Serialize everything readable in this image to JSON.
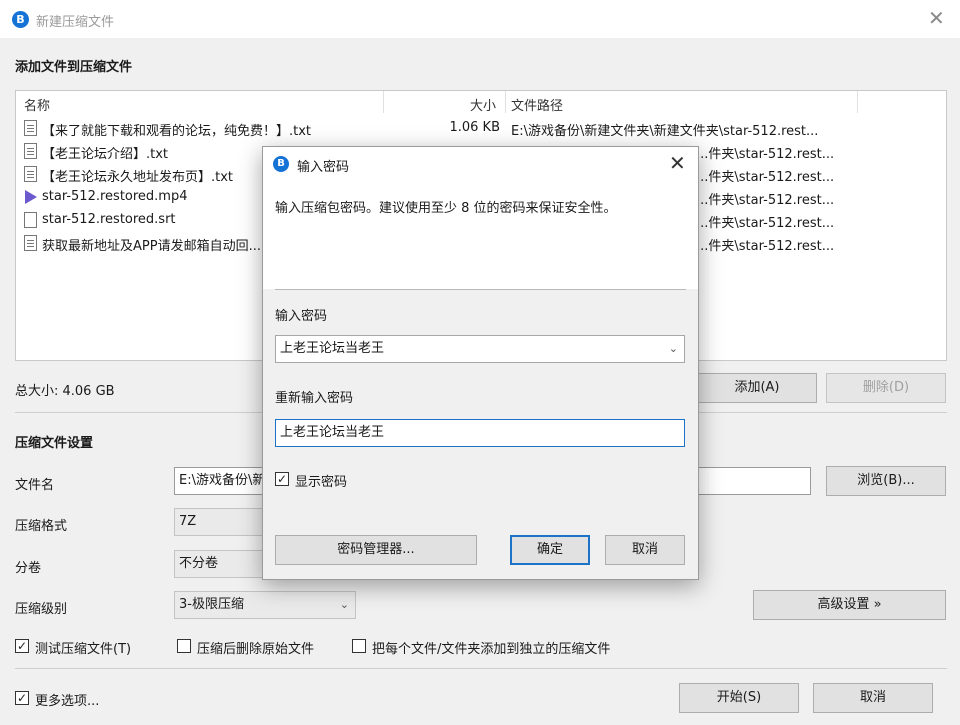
{
  "window": {
    "title": "新建压缩文件",
    "logo": "bandizip-logo-icon",
    "close_icon": "close-icon"
  },
  "add_files": {
    "section_title": "添加文件到压缩文件",
    "columns": {
      "name": "名称",
      "size": "大小",
      "path": "文件路径"
    },
    "files": [
      {
        "icon": "text-file-icon",
        "name": "【来了就能下载和观看的论坛，纯免费！】.txt",
        "size": "1.06 KB",
        "path": "E:\\游戏备份\\新建文件夹\\新建文件夹\\star-512.rest..."
      },
      {
        "icon": "text-file-icon",
        "name": "【老王论坛介绍】.txt",
        "size": "",
        "path": "...件夹\\star-512.rest..."
      },
      {
        "icon": "text-file-icon",
        "name": "【老王论坛永久地址发布页】.txt",
        "size": "",
        "path": "...件夹\\star-512.rest..."
      },
      {
        "icon": "video-file-icon",
        "name": "star-512.restored.mp4",
        "size": "",
        "path": "...件夹\\star-512.rest..."
      },
      {
        "icon": "blank-file-icon",
        "name": "star-512.restored.srt",
        "size": "",
        "path": "...件夹\\star-512.rest..."
      },
      {
        "icon": "text-file-icon",
        "name": "获取最新地址及APP请发邮箱自动回...",
        "size": "",
        "path": "...件夹\\star-512.rest..."
      }
    ],
    "total_size": "总大小: 4.06 GB",
    "add_button": "添加(A)",
    "delete_button": "删除(D)"
  },
  "settings": {
    "section_title": "压缩文件设置",
    "filename_label": "文件名",
    "filename_value": "E:\\游戏备份\\新",
    "browse_button": "浏览(B)...",
    "format_label": "压缩格式",
    "format_value": "7Z",
    "split_label": "分卷",
    "split_value": "不分卷",
    "level_label": "压缩级别",
    "level_value": "3-极限压缩",
    "advanced_button": "高级设置 »",
    "test_label": "测试压缩文件(T)",
    "test_checked": true,
    "delete_after_label": "压缩后删除原始文件",
    "delete_after_checked": false,
    "each_separate_label": "把每个文件/文件夹添加到独立的压缩文件",
    "each_separate_checked": false
  },
  "footer": {
    "more_options_label": "更多选项...",
    "more_options_checked": true,
    "start_button": "开始(S)",
    "cancel_button": "取消"
  },
  "dialog": {
    "title": "输入密码",
    "description": "输入压缩包密码。建议使用至少 8 位的密码来保证安全性。",
    "password_label": "输入密码",
    "password_value": "上老王论坛当老王",
    "confirm_label": "重新输入密码",
    "confirm_value": "上老王论坛当老王",
    "show_password_label": "显示密码",
    "show_password_checked": true,
    "manager_button": "密码管理器...",
    "ok_button": "确定",
    "cancel_button": "取消"
  },
  "glyphs": {
    "check": "✓",
    "dropdown": "⌄",
    "close": "✕",
    "logo_letter": "B"
  }
}
